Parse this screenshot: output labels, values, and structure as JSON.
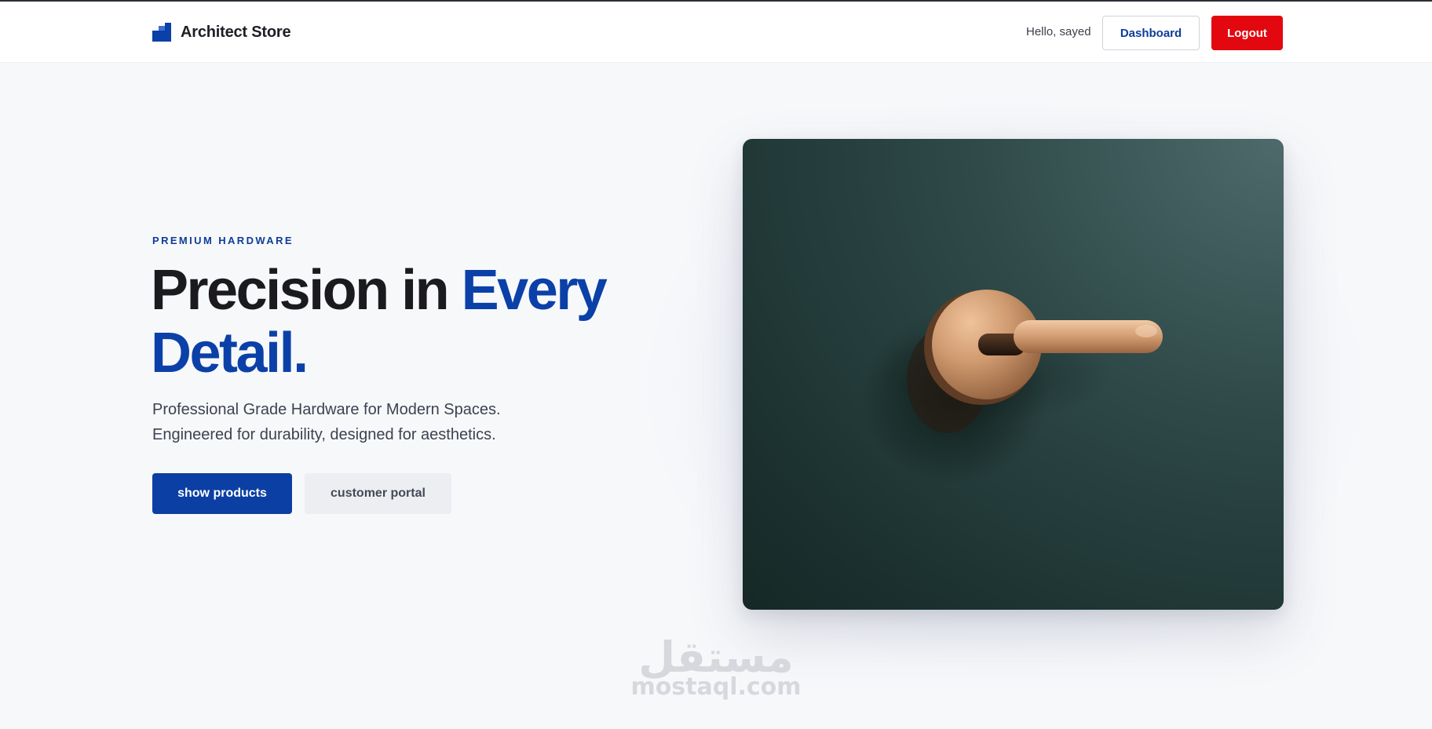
{
  "header": {
    "brand_name": "Architect Store",
    "brand_icon": "stairs-logo-icon",
    "greeting": "Hello, sayed",
    "dashboard_label": "Dashboard",
    "logout_label": "Logout"
  },
  "hero": {
    "eyebrow": "PREMIUM HARDWARE",
    "headline_part1": "Precision in ",
    "headline_accent": "Every Detail.",
    "subtext_line1": "Professional Grade Hardware for Modern Spaces.",
    "subtext_line2": "Engineered for durability, designed for aesthetics.",
    "primary_cta": "show products",
    "secondary_cta": "customer portal",
    "image_subject": "copper door handle on dark green wall"
  },
  "watermark": {
    "arabic": "مستقل",
    "latin": "mostaql.com"
  },
  "colors": {
    "brand_blue": "#0b40a8",
    "logout_red": "#e3080f",
    "background": "#f7f8fa",
    "image_bg": "#1e3533",
    "handle_copper": "#c89066"
  }
}
